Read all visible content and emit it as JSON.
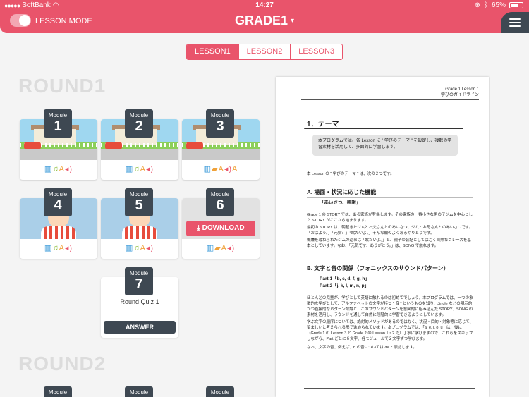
{
  "status": {
    "carrier": "SoftBank",
    "time": "14:27",
    "battery": "65%",
    "battery_level": 0.65
  },
  "header": {
    "lesson_mode": "LESSON MODE",
    "grade": "GRADE1",
    "grade_caret": "▾"
  },
  "tabs": [
    {
      "label": "LESSON1"
    },
    {
      "label": "LESSON2"
    },
    {
      "label": "LESSON3"
    }
  ],
  "rounds": {
    "round1": "ROUND1",
    "round2": "ROUND2"
  },
  "module_label": "Module",
  "modules": [
    {
      "num": "1"
    },
    {
      "num": "2"
    },
    {
      "num": "3"
    },
    {
      "num": "4"
    },
    {
      "num": "5"
    },
    {
      "num": "6"
    },
    {
      "num": "7"
    }
  ],
  "download_label": "DOWNLOAD",
  "quiz": {
    "title": "Round Quiz 1",
    "answer_label": "ANSWER"
  },
  "doc": {
    "head1": "Grade 1  Lesson 1",
    "head2": "学びのガイドライン",
    "section_title": "1．テーマ",
    "box_text": "本プログラムでは、各 Lesson に \" 学びのテーマ \" を設定し、複数の学習素材を活用して、多面的に学習します。",
    "intro": "本 Lesson の \" 学びのテーマ \" は、次の２つです。",
    "a_title": "A.  場面・状況に応じた機能",
    "a_sub": "「あいさつ、感謝」",
    "a_p1": "Grade 1 の STORY では、ある家族が登場します。その家族の一番小さな男の子ジムを中心とした STORY がここから始まります。",
    "a_p2": "最初の STORY は、朝起きたジムとお父さんとのあいさつ、ジムとお母さんとのあいさつです。「おはよう。」「元気？」「眠たいよ。」そんな朝のよくあるやりとりです。",
    "a_p3": "機嫌を尋ねられたジムの返事は「眠たいよ。」と、親子の会話としてはごく自然なフレーズを基本としています。なお、「元気です、ありがとう。」は、SONG で触れます。",
    "b_title": "B.  文字と音の関係（フォニックスのサウンドパターン）",
    "b_part1": "Part 1「b, c, d, f, g, h」",
    "b_part2": "Part 2「j, k, l, m, n, p」",
    "b_p1": "ほとんどの児童が、学びとして英語に触れるのは初めてでしょう。本プログラムでは、一つの象徴的な学びとして、アルファベットの文字が持つ \" 音 \" というものを知り、Jingle などの明示的かつ直接的なパターン認識と、このサウンドパターンを意図的に組み込んだ STORY、SONG の素材を活用し、ラウンドを通して自然に段階的に学習できるようにしています。",
    "b_p2": "学ぶ文字の順序については、絶対的メソッドがあるのではなく、状況・目的・対象等に応じて、望ましいと考えられる形で進められています。本プログラムでは、「a, e, i, o, u」は、後に（Grade 1 の Lesson 3 と Grade 2 の Lesson 1・2 で）丁寧に学びますので、これらをスキップしながら、Part ごとに６文字、各モジュールで２文字ずつ学びます。",
    "b_p3": "なお、文字の音、例えば、b の音については /b/ と表記します。"
  }
}
